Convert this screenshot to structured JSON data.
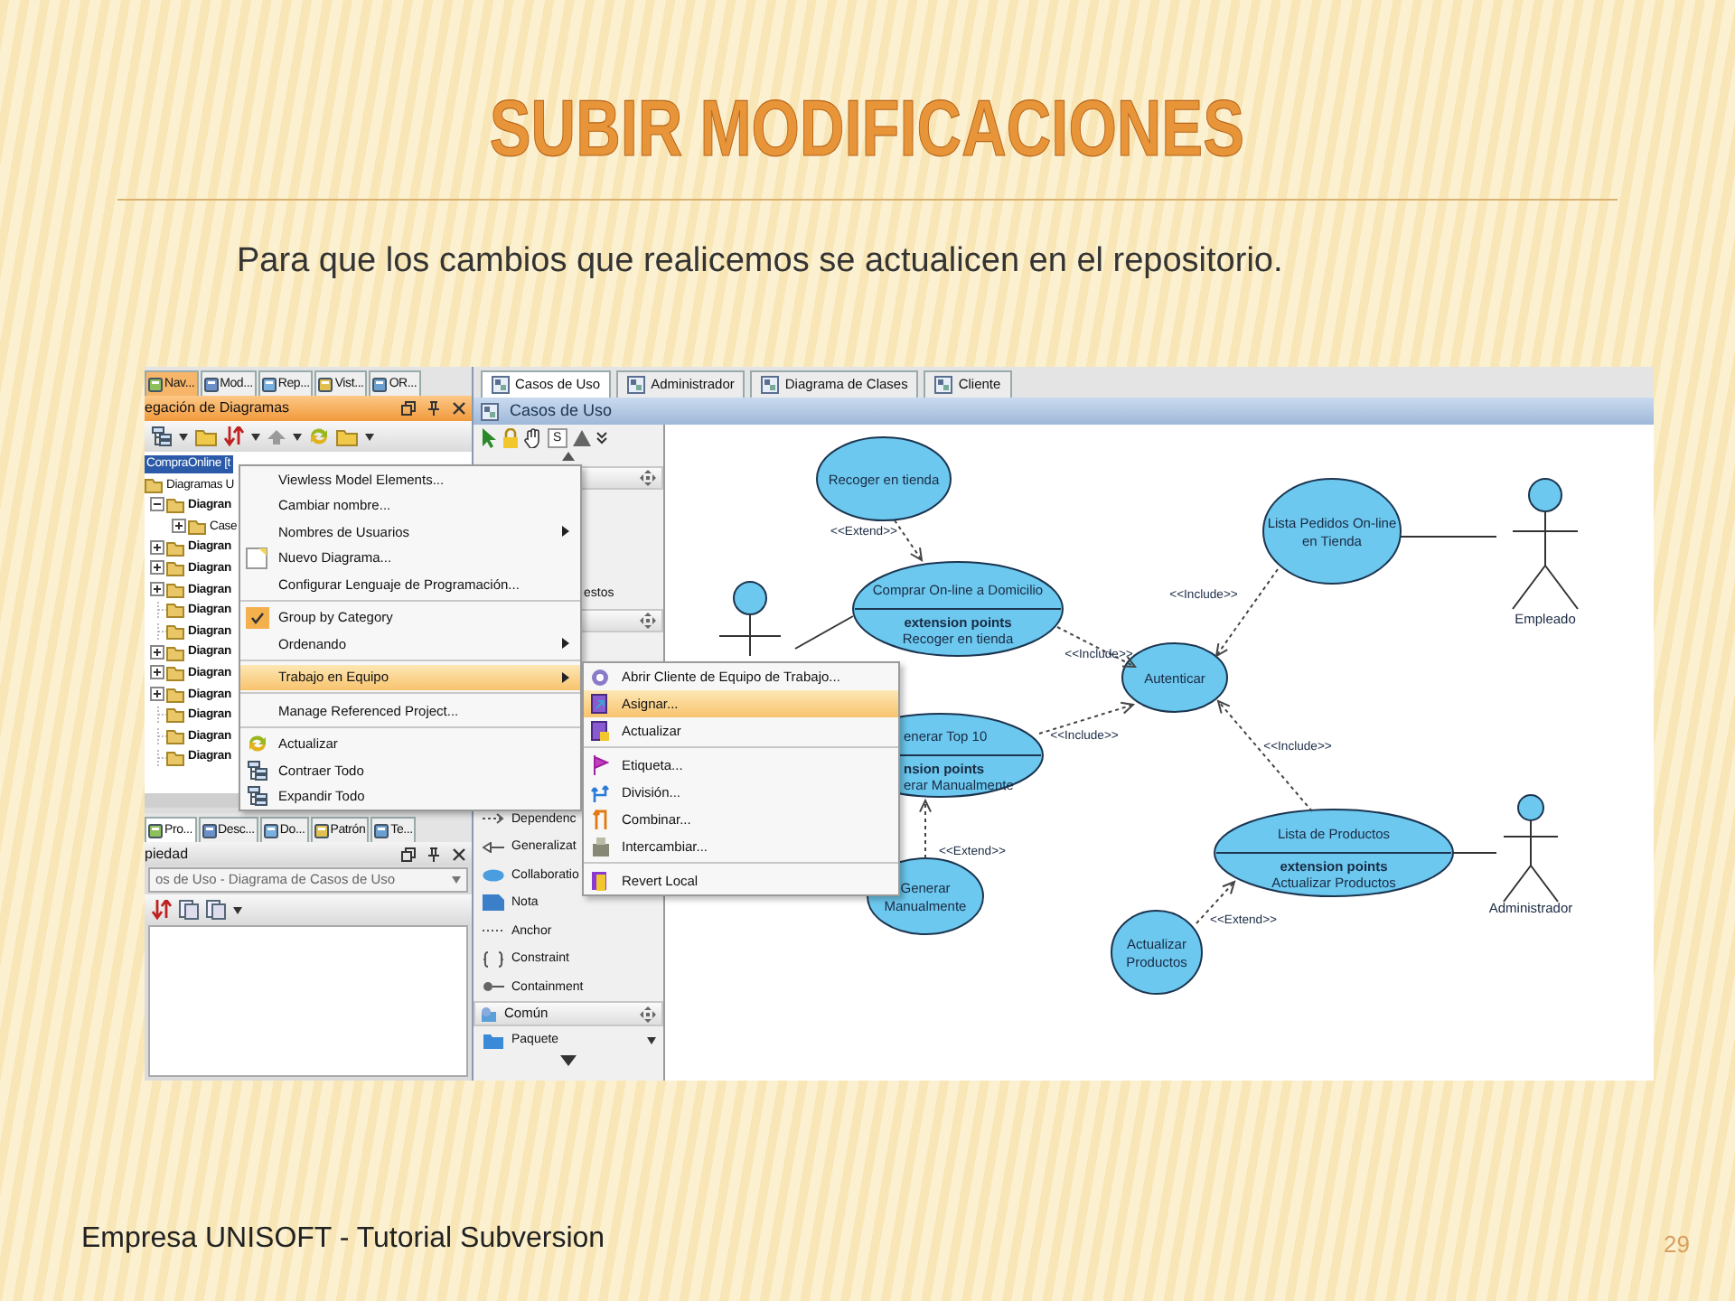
{
  "slide": {
    "title": "SUBIR MODIFICACIONES",
    "subtitle": "Para que los cambios que realicemos se actualicen en el repositorio.",
    "footer": "Empresa UNISOFT  -  Tutorial Subversion",
    "page_number": "29"
  },
  "navigator": {
    "tabs": [
      {
        "label": "Nav...",
        "selected": true
      },
      {
        "label": "Mod...",
        "selected": false
      },
      {
        "label": "Rep...",
        "selected": false
      },
      {
        "label": "Vist...",
        "selected": false
      },
      {
        "label": "OR...",
        "selected": false
      }
    ],
    "title": "egación de Diagramas",
    "tree": [
      {
        "label": "CompraOnline [t",
        "selected": true,
        "children": [
          {
            "label": "Diagramas U",
            "selected": false,
            "children": [
              {
                "label": "Diagran",
                "selected": false,
                "expanded": true,
                "children": [
                  {
                    "label": "Case",
                    "selected": false,
                    "expanded": false
                  }
                ]
              },
              {
                "label": "Diagran",
                "selected": false,
                "expanded": false
              },
              {
                "label": "Diagran",
                "selected": false,
                "expanded": false
              },
              {
                "label": "Diagran",
                "selected": false,
                "expanded": false
              },
              {
                "label": "Diagran",
                "selected": false
              },
              {
                "label": "Diagran",
                "selected": false
              },
              {
                "label": "Diagran",
                "selected": false,
                "expanded": false
              },
              {
                "label": "Diagran",
                "selected": false,
                "expanded": false
              },
              {
                "label": "Diagran",
                "selected": false,
                "expanded": false
              },
              {
                "label": "Diagran",
                "selected": false
              },
              {
                "label": "Diagran",
                "selected": false
              },
              {
                "label": "Diagran",
                "selected": false
              }
            ]
          }
        ]
      }
    ]
  },
  "properties": {
    "tabs": [
      {
        "label": "Pro...",
        "selected": true
      },
      {
        "label": "Desc...",
        "selected": false
      },
      {
        "label": "Do...",
        "selected": false
      },
      {
        "label": "Patrón",
        "selected": false
      },
      {
        "label": "Te...",
        "selected": false
      }
    ],
    "title": "piedad",
    "combo": "os de Uso - Diagrama de Casos de Uso"
  },
  "editor": {
    "tabs": [
      {
        "label": "Casos de Uso",
        "selected": true
      },
      {
        "label": "Administrador",
        "selected": false
      },
      {
        "label": "Diagrama de Clases",
        "selected": false
      },
      {
        "label": "Cliente",
        "selected": false
      }
    ],
    "title": "Casos de Uso"
  },
  "palette": {
    "key_label": "S",
    "partial_label": "estos",
    "tools": [
      "Dependenc",
      "Generalizat",
      "Collaboratio",
      "Nota",
      "Anchor",
      "Constraint",
      "Containment"
    ],
    "section": "Común",
    "bottom_tool": "Paquete"
  },
  "context_menu": [
    {
      "kind": "item",
      "label": "Viewless Model Elements...",
      "submenu": false,
      "checked": false,
      "selected": false
    },
    {
      "kind": "item",
      "label": "Cambiar nombre...",
      "submenu": false,
      "checked": false,
      "selected": false
    },
    {
      "kind": "item",
      "label": "Nombres de Usuarios",
      "submenu": true,
      "checked": false,
      "selected": false
    },
    {
      "kind": "item",
      "label": "Nuevo Diagrama...",
      "submenu": false,
      "checked": false,
      "selected": false
    },
    {
      "kind": "item",
      "label": "Configurar Lenguaje de Programación...",
      "submenu": false,
      "checked": false,
      "selected": false
    },
    {
      "kind": "separator"
    },
    {
      "kind": "item",
      "label": "Group by Category",
      "submenu": false,
      "checked": true,
      "selected": false
    },
    {
      "kind": "item",
      "label": "Ordenando",
      "submenu": true,
      "checked": false,
      "selected": false
    },
    {
      "kind": "separator"
    },
    {
      "kind": "item",
      "label": "Trabajo en Equipo",
      "submenu": true,
      "checked": false,
      "selected": true
    },
    {
      "kind": "separator"
    },
    {
      "kind": "item",
      "label": "Manage Referenced Project...",
      "submenu": false,
      "checked": false,
      "selected": false
    },
    {
      "kind": "separator"
    },
    {
      "kind": "item",
      "label": "Actualizar",
      "submenu": false,
      "checked": false,
      "selected": false
    },
    {
      "kind": "item",
      "label": "Contraer Todo",
      "submenu": false,
      "checked": false,
      "selected": false
    },
    {
      "kind": "item",
      "label": "Expandir Todo",
      "submenu": false,
      "checked": false,
      "selected": false
    }
  ],
  "submenu": [
    {
      "kind": "item",
      "label": "Abrir Cliente de Equipo de Trabajo...",
      "selected": false
    },
    {
      "kind": "item",
      "label": "Asignar...",
      "selected": true
    },
    {
      "kind": "item",
      "label": "Actualizar",
      "selected": false
    },
    {
      "kind": "separator"
    },
    {
      "kind": "item",
      "label": "Etiqueta...",
      "selected": false
    },
    {
      "kind": "item",
      "label": "División...",
      "selected": false
    },
    {
      "kind": "item",
      "label": "Combinar...",
      "selected": false
    },
    {
      "kind": "item",
      "label": "Intercambiar...",
      "selected": false
    },
    {
      "kind": "separator"
    },
    {
      "kind": "item",
      "label": "Revert Local",
      "selected": false
    }
  ],
  "diagram": {
    "use_cases": [
      {
        "lines": [
          "Recoger en tienda"
        ]
      },
      {
        "lines": [
          "Comprar On-line a Domicilio"
        ],
        "extension_heading": "extension points",
        "extension_point": "Recoger en tienda"
      },
      {
        "lines": [
          "Autenticar"
        ]
      },
      {
        "lines": [
          "Lista Pedidos On-line",
          "en Tienda"
        ]
      },
      {
        "lines": [
          "enerar Top 10"
        ],
        "extension_heading": "nsion points",
        "extension_point": "erar Manualmente"
      },
      {
        "lines": [
          "Lista de Productos"
        ],
        "extension_heading": "extension points",
        "extension_point": "Actualizar Productos"
      },
      {
        "lines": [
          "Generar",
          "Manualmente"
        ]
      },
      {
        "lines": [
          "Actualizar",
          "Productos"
        ]
      }
    ],
    "actors": [
      {
        "name": "Empleado"
      },
      {
        "name": "Administrador"
      }
    ],
    "relations": [
      {
        "label": "<<Extend>>"
      },
      {
        "label": "<<Include>>"
      },
      {
        "label": "<<Include>>"
      },
      {
        "label": "<<Include>>"
      },
      {
        "label": "<<Include>>"
      },
      {
        "label": "<<Extend>>"
      },
      {
        "label": "<<Extend>>"
      }
    ]
  }
}
